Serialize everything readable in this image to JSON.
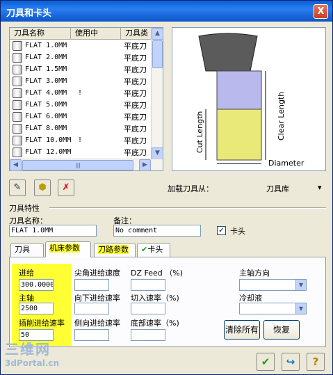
{
  "window": {
    "title": "刀具和卡头",
    "close_glyph": "X"
  },
  "tool_list": {
    "columns": [
      "刀具名称",
      "使用中",
      "刀具类"
    ],
    "rows": [
      {
        "name": "FLAT 1.0MM",
        "in_use": "",
        "type": "平底刀"
      },
      {
        "name": "FLAT 2.0MM",
        "in_use": "",
        "type": "平底刀"
      },
      {
        "name": "FLAT 1.5MM",
        "in_use": "",
        "type": "平底刀"
      },
      {
        "name": "FLAT 3.0MM",
        "in_use": "",
        "type": "平底刀"
      },
      {
        "name": "FLAT 4.0MM",
        "in_use": "!",
        "type": "平底刀"
      },
      {
        "name": "FLAT 5.0MM",
        "in_use": "",
        "type": "平底刀"
      },
      {
        "name": "FLAT 6.0MM",
        "in_use": "",
        "type": "平底刀"
      },
      {
        "name": "FLAT 8.0MM",
        "in_use": "",
        "type": "平底刀"
      },
      {
        "name": "FLAT 10.0MM",
        "in_use": "!",
        "type": "平底刀"
      },
      {
        "name": "FLAT 12.0MM",
        "in_use": "",
        "type": "平底刀"
      }
    ],
    "scroll": {
      "up": "▲",
      "down": "▼",
      "left": "◀",
      "right": "▶",
      "grip": "|||"
    }
  },
  "diagram": {
    "cut_length": "Cut Length",
    "clear_length": "Clear Length",
    "diameter": "Diameter"
  },
  "toolbar": {
    "load_from_label": "加载刀具从：",
    "load_from_value": "刀具库",
    "combo_arrow": "▾"
  },
  "tool_props": {
    "section_label": "刀具特性",
    "name_label": "刀具名称：",
    "name_value": "FLAT 1.0MM",
    "note_label": "备注：",
    "note_value": "No comment",
    "holder_check_label": "卡头",
    "holder_check_mark": "✓"
  },
  "tabs": [
    {
      "label": "刀具"
    },
    {
      "label": "机床参数"
    },
    {
      "label": "刀路参数"
    },
    {
      "label": "卡头"
    }
  ],
  "machine_params": {
    "feed_label": "进给",
    "feed_value": "300.0000",
    "spindle_label": "主轴",
    "spindle_value": "2500",
    "plunge_label": "插削进给速率",
    "plunge_value": "50",
    "tip_feed_label": "尖角进给速度",
    "dz_feed_label": "DZ Feed （%)",
    "down_feed_label": "向下进给速率",
    "cut_in_label": "切入速率（%)",
    "side_feed_label": "侧向进给速率",
    "bottom_label": "底部速率（%)",
    "spindle_dir_label": "主轴方向",
    "coolant_label": "冷却液",
    "clear_all_label": "清除所有",
    "restore_label": "恢复",
    "dd_arrow": "▼"
  },
  "footer": {
    "ok_glyph": "✔",
    "apply_glyph": "↪",
    "help_glyph": "?"
  },
  "watermark": {
    "line1": "三维网",
    "line2": "3dPortal.cn"
  }
}
